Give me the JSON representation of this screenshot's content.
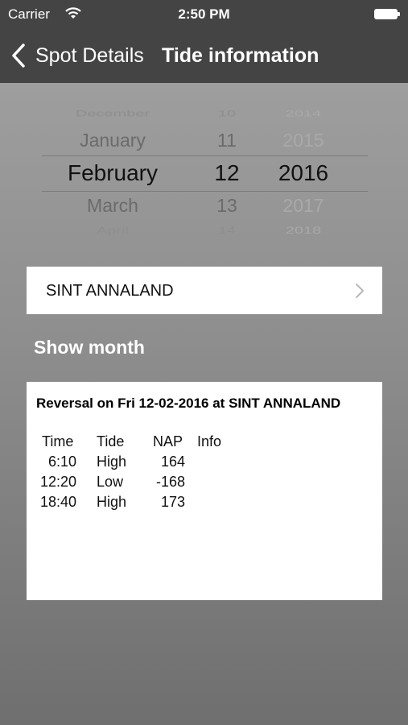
{
  "status_bar": {
    "carrier": "Carrier",
    "time": "2:50 PM"
  },
  "nav": {
    "back_label": "Spot Details",
    "title": "Tide information"
  },
  "picker": {
    "months": [
      "December",
      "January",
      "February",
      "March",
      "April"
    ],
    "days": [
      "10",
      "11",
      "12",
      "13",
      "14"
    ],
    "years": [
      "2014",
      "2015",
      "2016",
      "2017",
      "2018"
    ],
    "selected": {
      "month": "February",
      "day": "12",
      "year": "2016"
    }
  },
  "location": {
    "label": "SINT ANNALAND"
  },
  "show_month": {
    "label": "Show month"
  },
  "tide_card": {
    "title": "Reversal on Fri 12-02-2016 at SINT ANNALAND",
    "headers": {
      "time": "Time",
      "tide": "Tide",
      "nap": "NAP",
      "info": "Info"
    },
    "rows": [
      {
        "time": "6:10",
        "tide": "High",
        "nap": "164",
        "info": ""
      },
      {
        "time": "12:20",
        "tide": "Low",
        "nap": "-168",
        "info": ""
      },
      {
        "time": "18:40",
        "tide": "High",
        "nap": "173",
        "info": ""
      }
    ]
  },
  "colors": {
    "nav_bar": "#444444",
    "background": "#8e8e8e",
    "card": "#ffffff"
  }
}
